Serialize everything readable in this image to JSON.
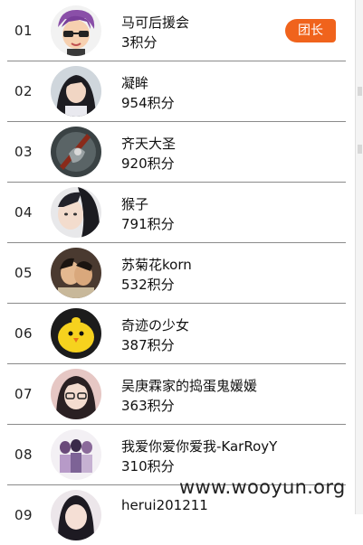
{
  "leader_badge": "团长",
  "watermark": "www.wooyun.org",
  "rows": [
    {
      "rank": "01",
      "name": "马可后援会",
      "points": "3积分"
    },
    {
      "rank": "02",
      "name": "凝眸",
      "points": "954积分"
    },
    {
      "rank": "03",
      "name": "齐天大圣",
      "points": "920积分"
    },
    {
      "rank": "04",
      "name": "猴子",
      "points": "791积分"
    },
    {
      "rank": "05",
      "name": "苏菊花korn",
      "points": "532积分"
    },
    {
      "rank": "06",
      "name": "奇迹の少女",
      "points": "387积分"
    },
    {
      "rank": "07",
      "name": "吴庚霖家的捣蛋鬼媛媛",
      "points": "363积分"
    },
    {
      "rank": "08",
      "name": "我爱你爱你爱我-KarRoyY",
      "points": "310积分"
    },
    {
      "rank": "09",
      "name": "herui201211",
      "points": ""
    }
  ],
  "colors": {
    "badge": "#f0631c",
    "divider": "#8a8a8a"
  }
}
